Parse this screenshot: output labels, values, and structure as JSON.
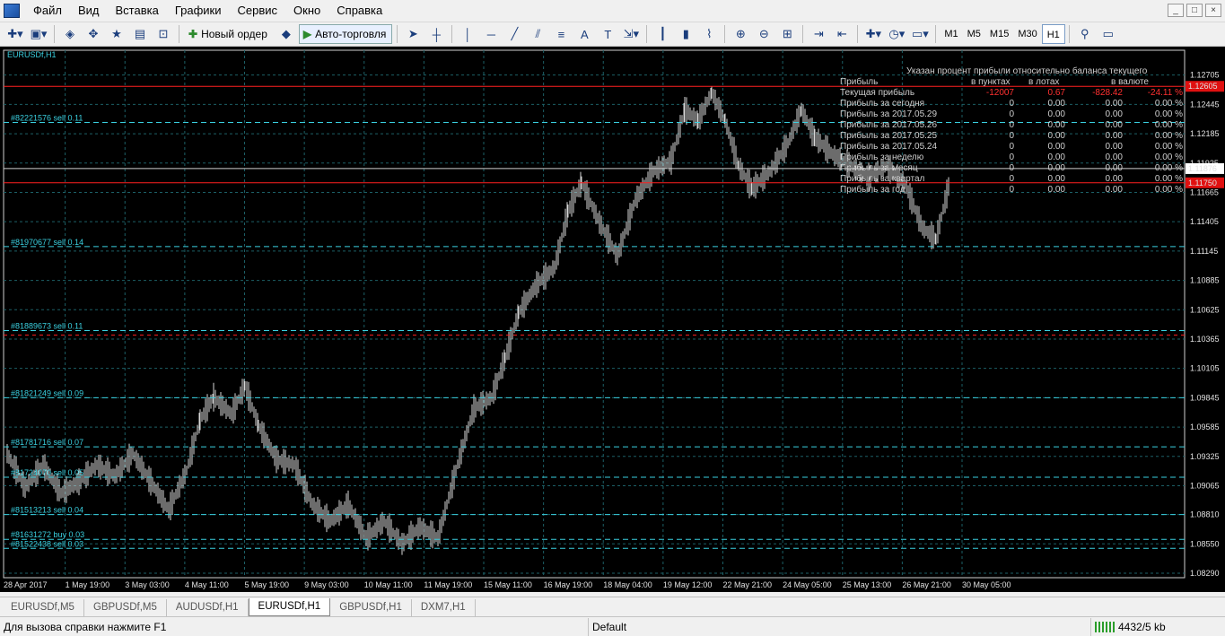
{
  "menu": [
    "Файл",
    "Вид",
    "Вставка",
    "Графики",
    "Сервис",
    "Окно",
    "Справка"
  ],
  "window_controls": [
    "_",
    "□",
    "×"
  ],
  "toolbar": {
    "new_order_label": "Новый ордер",
    "autotrading_label": "Авто-торговля",
    "timeframes": [
      "M1",
      "M5",
      "M15",
      "M30",
      "H1"
    ],
    "active_timeframe": "H1"
  },
  "chart": {
    "symbol_label": "EURUSDf,H1",
    "colors": {
      "background": "#000000",
      "grid": "#1c5f66",
      "order_line": "#3ad0e0",
      "sl_line": "#ff2020",
      "candle": "#d8d8d8"
    },
    "price_ticks": [
      "1.12705",
      "1.12445",
      "1.12185",
      "1.11925",
      "1.11665",
      "1.11405",
      "1.11145",
      "1.10885",
      "1.10625",
      "1.10365",
      "1.10105",
      "1.09845",
      "1.09585",
      "1.09325",
      "1.09065",
      "1.08810",
      "1.08550",
      "1.08290"
    ],
    "date_ticks": [
      "28 Apr 2017",
      "1 May 19:00",
      "3 May 03:00",
      "4 May 11:00",
      "5 May 19:00",
      "9 May 03:00",
      "10 May 11:00",
      "11 May 19:00",
      "15 May 11:00",
      "16 May 19:00",
      "18 May 04:00",
      "19 May 12:00",
      "22 May 21:00",
      "24 May 05:00",
      "25 May 13:00",
      "26 May 21:00",
      "30 May 05:00"
    ],
    "price_markers": {
      "top_red": "1.12605",
      "current": "1.11876",
      "bottom_red": "1.11750"
    },
    "order_labels": [
      {
        "text": "#82221576 sell 0.11",
        "price": 1.12285
      },
      {
        "text": "#81970677 sell 0.14",
        "price": 1.11185
      },
      {
        "text": "#81889673 sell 0.11",
        "price": 1.1044
      },
      {
        "text": "#81821249 sell 0.09",
        "price": 1.09845
      },
      {
        "text": "#81781716 sell 0.07",
        "price": 1.0941
      },
      {
        "text": "#81724070 sell 0.05",
        "price": 1.0914
      },
      {
        "text": "#81513213 sell 0.04",
        "price": 1.0881
      },
      {
        "text": "#81631272 buy 0.03",
        "price": 1.0859
      },
      {
        "text": "#81522438 sell 0.03",
        "price": 1.0851
      }
    ]
  },
  "profit_panel": {
    "title": "Указан процент прибыли относительно баланса текущего",
    "headers": [
      "Прибыль",
      "в пунктах",
      "в лотах",
      "в валюте"
    ],
    "rows": [
      {
        "label": "Текущая прибыль",
        "points": "-12007",
        "lots": "0.67",
        "currency": "-828.42",
        "percent": "-24.11 %",
        "red": true
      },
      {
        "label": "Прибыль за сегодня",
        "points": "0",
        "lots": "0.00",
        "currency": "0.00",
        "percent": "0.00 %",
        "red": false
      },
      {
        "label": "Прибыль за 2017.05.29",
        "points": "0",
        "lots": "0.00",
        "currency": "0.00",
        "percent": "0.00 %",
        "red": false
      },
      {
        "label": "Прибыль за 2017.05.26",
        "points": "0",
        "lots": "0.00",
        "currency": "0.00",
        "percent": "0.00 %",
        "red": false
      },
      {
        "label": "Прибыль за 2017.05.25",
        "points": "0",
        "lots": "0.00",
        "currency": "0.00",
        "percent": "0.00 %",
        "red": false
      },
      {
        "label": "Прибыль за 2017.05.24",
        "points": "0",
        "lots": "0.00",
        "currency": "0.00",
        "percent": "0.00 %",
        "red": false
      },
      {
        "label": "Прибыль за неделю",
        "points": "0",
        "lots": "0.00",
        "currency": "0.00",
        "percent": "0.00 %",
        "red": false
      },
      {
        "label": "Прибыль за месяц",
        "points": "0",
        "lots": "0.00",
        "currency": "0.00",
        "percent": "0.00 %",
        "red": false
      },
      {
        "label": "Прибыль за квартал",
        "points": "0",
        "lots": "0.00",
        "currency": "0.00",
        "percent": "0.00 %",
        "red": false
      },
      {
        "label": "Прибыль за год",
        "points": "0",
        "lots": "0.00",
        "currency": "0.00",
        "percent": "0.00 %",
        "red": false
      }
    ]
  },
  "tabs": [
    "EURUSDf,M5",
    "GBPUSDf,M5",
    "AUDUSDf,H1",
    "EURUSDf,H1",
    "GBPUSDf,H1",
    "DXM7,H1"
  ],
  "active_tab": "EURUSDf,H1",
  "statusbar": {
    "help_text": "Для вызова справки нажмите F1",
    "profile": "Default",
    "traffic": "4432/5 kb"
  }
}
